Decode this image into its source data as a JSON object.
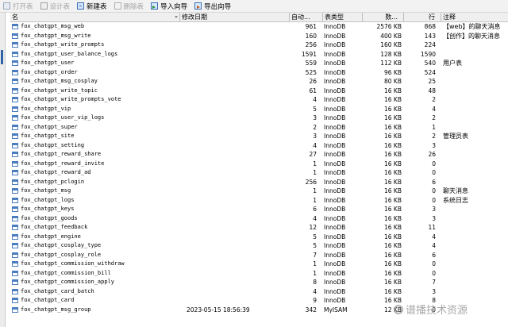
{
  "toolbar": {
    "open": "打开表",
    "design": "设计表",
    "new": "新建表",
    "delete": "删除表",
    "import": "导入向导",
    "export": "导出向导"
  },
  "columns": {
    "name": "名",
    "modified": "修改日期",
    "auto_increment": "自动...",
    "table_type": "表类型",
    "data_length": "数...",
    "rows": "行",
    "comment": "注释"
  },
  "tables": [
    {
      "name": "fox_chatgpt_msg_web",
      "modified": "",
      "auto_increment": "961",
      "type": "InnoDB",
      "data_length": "2576 KB",
      "rows": "868",
      "comment": "【web】的聊天消息"
    },
    {
      "name": "fox_chatgpt_msg_write",
      "modified": "",
      "auto_increment": "160",
      "type": "InnoDB",
      "data_length": "400 KB",
      "rows": "143",
      "comment": "【创作】的聊天消息"
    },
    {
      "name": "fox_chatgpt_write_prompts",
      "modified": "",
      "auto_increment": "256",
      "type": "InnoDB",
      "data_length": "160 KB",
      "rows": "224",
      "comment": ""
    },
    {
      "name": "fox_chatgpt_user_balance_logs",
      "modified": "",
      "auto_increment": "1591",
      "type": "InnoDB",
      "data_length": "128 KB",
      "rows": "1590",
      "comment": ""
    },
    {
      "name": "fox_chatgpt_user",
      "modified": "",
      "auto_increment": "559",
      "type": "InnoDB",
      "data_length": "112 KB",
      "rows": "540",
      "comment": "用户表"
    },
    {
      "name": "fox_chatgpt_order",
      "modified": "",
      "auto_increment": "525",
      "type": "InnoDB",
      "data_length": "96 KB",
      "rows": "524",
      "comment": ""
    },
    {
      "name": "fox_chatgpt_msg_cosplay",
      "modified": "",
      "auto_increment": "26",
      "type": "InnoDB",
      "data_length": "80 KB",
      "rows": "25",
      "comment": ""
    },
    {
      "name": "fox_chatgpt_write_topic",
      "modified": "",
      "auto_increment": "61",
      "type": "InnoDB",
      "data_length": "16 KB",
      "rows": "48",
      "comment": ""
    },
    {
      "name": "fox_chatgpt_write_prompts_vote",
      "modified": "",
      "auto_increment": "4",
      "type": "InnoDB",
      "data_length": "16 KB",
      "rows": "2",
      "comment": ""
    },
    {
      "name": "fox_chatgpt_vip",
      "modified": "",
      "auto_increment": "5",
      "type": "InnoDB",
      "data_length": "16 KB",
      "rows": "4",
      "comment": ""
    },
    {
      "name": "fox_chatgpt_user_vip_logs",
      "modified": "",
      "auto_increment": "3",
      "type": "InnoDB",
      "data_length": "16 KB",
      "rows": "2",
      "comment": ""
    },
    {
      "name": "fox_chatgpt_super",
      "modified": "",
      "auto_increment": "2",
      "type": "InnoDB",
      "data_length": "16 KB",
      "rows": "1",
      "comment": ""
    },
    {
      "name": "fox_chatgpt_site",
      "modified": "",
      "auto_increment": "3",
      "type": "InnoDB",
      "data_length": "16 KB",
      "rows": "2",
      "comment": "管理员表"
    },
    {
      "name": "fox_chatgpt_setting",
      "modified": "",
      "auto_increment": "4",
      "type": "InnoDB",
      "data_length": "16 KB",
      "rows": "3",
      "comment": ""
    },
    {
      "name": "fox_chatgpt_reward_share",
      "modified": "",
      "auto_increment": "27",
      "type": "InnoDB",
      "data_length": "16 KB",
      "rows": "26",
      "comment": ""
    },
    {
      "name": "fox_chatgpt_reward_invite",
      "modified": "",
      "auto_increment": "1",
      "type": "InnoDB",
      "data_length": "16 KB",
      "rows": "0",
      "comment": ""
    },
    {
      "name": "fox_chatgpt_reward_ad",
      "modified": "",
      "auto_increment": "1",
      "type": "InnoDB",
      "data_length": "16 KB",
      "rows": "0",
      "comment": ""
    },
    {
      "name": "fox_chatgpt_pclogin",
      "modified": "",
      "auto_increment": "256",
      "type": "InnoDB",
      "data_length": "16 KB",
      "rows": "6",
      "comment": ""
    },
    {
      "name": "fox_chatgpt_msg",
      "modified": "",
      "auto_increment": "1",
      "type": "InnoDB",
      "data_length": "16 KB",
      "rows": "0",
      "comment": "聊天消息"
    },
    {
      "name": "fox_chatgpt_logs",
      "modified": "",
      "auto_increment": "1",
      "type": "InnoDB",
      "data_length": "16 KB",
      "rows": "0",
      "comment": "系统日志"
    },
    {
      "name": "fox_chatgpt_keys",
      "modified": "",
      "auto_increment": "6",
      "type": "InnoDB",
      "data_length": "16 KB",
      "rows": "3",
      "comment": ""
    },
    {
      "name": "fox_chatgpt_goods",
      "modified": "",
      "auto_increment": "4",
      "type": "InnoDB",
      "data_length": "16 KB",
      "rows": "3",
      "comment": ""
    },
    {
      "name": "fox_chatgpt_feedback",
      "modified": "",
      "auto_increment": "12",
      "type": "InnoDB",
      "data_length": "16 KB",
      "rows": "11",
      "comment": ""
    },
    {
      "name": "fox_chatgpt_engine",
      "modified": "",
      "auto_increment": "5",
      "type": "InnoDB",
      "data_length": "16 KB",
      "rows": "4",
      "comment": ""
    },
    {
      "name": "fox_chatgpt_cosplay_type",
      "modified": "",
      "auto_increment": "5",
      "type": "InnoDB",
      "data_length": "16 KB",
      "rows": "4",
      "comment": ""
    },
    {
      "name": "fox_chatgpt_cosplay_role",
      "modified": "",
      "auto_increment": "7",
      "type": "InnoDB",
      "data_length": "16 KB",
      "rows": "6",
      "comment": ""
    },
    {
      "name": "fox_chatgpt_commission_withdraw",
      "modified": "",
      "auto_increment": "1",
      "type": "InnoDB",
      "data_length": "16 KB",
      "rows": "0",
      "comment": ""
    },
    {
      "name": "fox_chatgpt_commission_bill",
      "modified": "",
      "auto_increment": "1",
      "type": "InnoDB",
      "data_length": "16 KB",
      "rows": "0",
      "comment": ""
    },
    {
      "name": "fox_chatgpt_commission_apply",
      "modified": "",
      "auto_increment": "8",
      "type": "InnoDB",
      "data_length": "16 KB",
      "rows": "7",
      "comment": ""
    },
    {
      "name": "fox_chatgpt_card_batch",
      "modified": "",
      "auto_increment": "4",
      "type": "InnoDB",
      "data_length": "16 KB",
      "rows": "3",
      "comment": ""
    },
    {
      "name": "fox_chatgpt_card",
      "modified": "",
      "auto_increment": "9",
      "type": "InnoDB",
      "data_length": "16 KB",
      "rows": "8",
      "comment": ""
    },
    {
      "name": "fox_chatgpt_msg_group",
      "modified": "2023-05-15 18:56:39",
      "auto_increment": "342",
      "type": "MyISAM",
      "data_length": "12 KB",
      "rows": "0",
      "comment": ""
    }
  ],
  "watermark": "谱播技术资源"
}
